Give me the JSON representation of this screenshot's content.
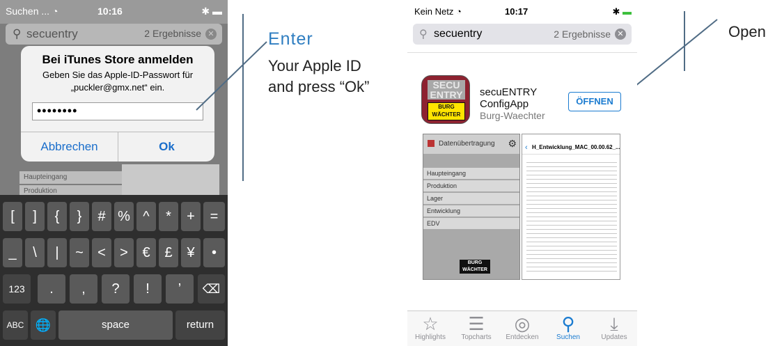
{
  "left_phone": {
    "status": {
      "carrier": "Suchen ...",
      "wifi_icon": "wifi-icon",
      "time": "10:16",
      "battery_icon": "battery-icon"
    },
    "search": {
      "query": "secuentry",
      "results": "2 Ergebnisse"
    },
    "background_rows": [
      "Haupteingang",
      "Produktion"
    ],
    "dialog": {
      "title": "Bei iTunes Store anmelden",
      "message": "Geben Sie das Apple-ID-Passwort für „puckler@gmx.net“ ein.",
      "password": "••••••••",
      "cancel_label": "Abbrechen",
      "ok_label": "Ok"
    },
    "keyboard": {
      "row1": [
        "[",
        "]",
        "{",
        "}",
        "#",
        "%",
        "^",
        "*",
        "+",
        "="
      ],
      "row2": [
        "_",
        "\\",
        "|",
        "~",
        "<",
        ">",
        "€",
        "£",
        "¥",
        "•"
      ],
      "row3": [
        ".",
        ",",
        "?",
        "!",
        "’"
      ],
      "numbers_label": "123",
      "abc_label": "ABC",
      "space_label": "space",
      "return_label": "return"
    }
  },
  "annotation_left": {
    "title": "Enter",
    "body": "Your Apple ID and press “Ok”"
  },
  "annotation_right": {
    "text": "Open"
  },
  "right_phone": {
    "status": {
      "carrier": "Kein Netz",
      "time": "10:17"
    },
    "search": {
      "query": "secuentry",
      "results": "2 Ergebnisse"
    },
    "app": {
      "name_line1": "secuENTRY",
      "name_line2": "ConfigApp",
      "developer": "Burg-Waechter",
      "open_label": "ÖFFNEN",
      "icon_text": "SECU ENTRY",
      "icon_logo": "BURG WÄCHTER"
    },
    "screenshot1": {
      "title": "Datenübertragung",
      "rows": [
        "Haupteingang",
        "Produktion",
        "Lager",
        "Entwicklung",
        "EDV"
      ],
      "logo": "BURG WÄCHTER"
    },
    "screenshot2": {
      "title": "H_Entwicklung_MAC_00.00.62_..."
    },
    "tabs": [
      {
        "label": "Highlights",
        "icon": "star-icon"
      },
      {
        "label": "Topcharts",
        "icon": "list-icon"
      },
      {
        "label": "Entdecken",
        "icon": "compass-icon"
      },
      {
        "label": "Suchen",
        "icon": "search-icon"
      },
      {
        "label": "Updates",
        "icon": "download-icon"
      }
    ],
    "active_tab": "Suchen"
  },
  "colors": {
    "ios_blue": "#1a7bd0",
    "annotation_blue": "#2f7ec1",
    "annotation_line": "#506c85",
    "app_icon_red": "#8d2230",
    "logo_yellow": "#ffe400"
  }
}
